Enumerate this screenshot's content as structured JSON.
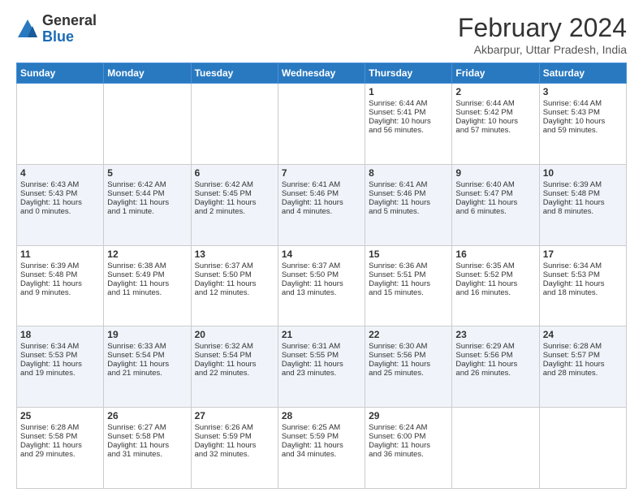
{
  "logo": {
    "general": "General",
    "blue": "Blue"
  },
  "title": "February 2024",
  "location": "Akbarpur, Uttar Pradesh, India",
  "headers": [
    "Sunday",
    "Monday",
    "Tuesday",
    "Wednesday",
    "Thursday",
    "Friday",
    "Saturday"
  ],
  "rows": [
    [
      {
        "day": "",
        "lines": []
      },
      {
        "day": "",
        "lines": []
      },
      {
        "day": "",
        "lines": []
      },
      {
        "day": "",
        "lines": []
      },
      {
        "day": "1",
        "lines": [
          "Sunrise: 6:44 AM",
          "Sunset: 5:41 PM",
          "Daylight: 10 hours",
          "and 56 minutes."
        ]
      },
      {
        "day": "2",
        "lines": [
          "Sunrise: 6:44 AM",
          "Sunset: 5:42 PM",
          "Daylight: 10 hours",
          "and 57 minutes."
        ]
      },
      {
        "day": "3",
        "lines": [
          "Sunrise: 6:44 AM",
          "Sunset: 5:43 PM",
          "Daylight: 10 hours",
          "and 59 minutes."
        ]
      }
    ],
    [
      {
        "day": "4",
        "lines": [
          "Sunrise: 6:43 AM",
          "Sunset: 5:43 PM",
          "Daylight: 11 hours",
          "and 0 minutes."
        ]
      },
      {
        "day": "5",
        "lines": [
          "Sunrise: 6:42 AM",
          "Sunset: 5:44 PM",
          "Daylight: 11 hours",
          "and 1 minute."
        ]
      },
      {
        "day": "6",
        "lines": [
          "Sunrise: 6:42 AM",
          "Sunset: 5:45 PM",
          "Daylight: 11 hours",
          "and 2 minutes."
        ]
      },
      {
        "day": "7",
        "lines": [
          "Sunrise: 6:41 AM",
          "Sunset: 5:46 PM",
          "Daylight: 11 hours",
          "and 4 minutes."
        ]
      },
      {
        "day": "8",
        "lines": [
          "Sunrise: 6:41 AM",
          "Sunset: 5:46 PM",
          "Daylight: 11 hours",
          "and 5 minutes."
        ]
      },
      {
        "day": "9",
        "lines": [
          "Sunrise: 6:40 AM",
          "Sunset: 5:47 PM",
          "Daylight: 11 hours",
          "and 6 minutes."
        ]
      },
      {
        "day": "10",
        "lines": [
          "Sunrise: 6:39 AM",
          "Sunset: 5:48 PM",
          "Daylight: 11 hours",
          "and 8 minutes."
        ]
      }
    ],
    [
      {
        "day": "11",
        "lines": [
          "Sunrise: 6:39 AM",
          "Sunset: 5:48 PM",
          "Daylight: 11 hours",
          "and 9 minutes."
        ]
      },
      {
        "day": "12",
        "lines": [
          "Sunrise: 6:38 AM",
          "Sunset: 5:49 PM",
          "Daylight: 11 hours",
          "and 11 minutes."
        ]
      },
      {
        "day": "13",
        "lines": [
          "Sunrise: 6:37 AM",
          "Sunset: 5:50 PM",
          "Daylight: 11 hours",
          "and 12 minutes."
        ]
      },
      {
        "day": "14",
        "lines": [
          "Sunrise: 6:37 AM",
          "Sunset: 5:50 PM",
          "Daylight: 11 hours",
          "and 13 minutes."
        ]
      },
      {
        "day": "15",
        "lines": [
          "Sunrise: 6:36 AM",
          "Sunset: 5:51 PM",
          "Daylight: 11 hours",
          "and 15 minutes."
        ]
      },
      {
        "day": "16",
        "lines": [
          "Sunrise: 6:35 AM",
          "Sunset: 5:52 PM",
          "Daylight: 11 hours",
          "and 16 minutes."
        ]
      },
      {
        "day": "17",
        "lines": [
          "Sunrise: 6:34 AM",
          "Sunset: 5:53 PM",
          "Daylight: 11 hours",
          "and 18 minutes."
        ]
      }
    ],
    [
      {
        "day": "18",
        "lines": [
          "Sunrise: 6:34 AM",
          "Sunset: 5:53 PM",
          "Daylight: 11 hours",
          "and 19 minutes."
        ]
      },
      {
        "day": "19",
        "lines": [
          "Sunrise: 6:33 AM",
          "Sunset: 5:54 PM",
          "Daylight: 11 hours",
          "and 21 minutes."
        ]
      },
      {
        "day": "20",
        "lines": [
          "Sunrise: 6:32 AM",
          "Sunset: 5:54 PM",
          "Daylight: 11 hours",
          "and 22 minutes."
        ]
      },
      {
        "day": "21",
        "lines": [
          "Sunrise: 6:31 AM",
          "Sunset: 5:55 PM",
          "Daylight: 11 hours",
          "and 23 minutes."
        ]
      },
      {
        "day": "22",
        "lines": [
          "Sunrise: 6:30 AM",
          "Sunset: 5:56 PM",
          "Daylight: 11 hours",
          "and 25 minutes."
        ]
      },
      {
        "day": "23",
        "lines": [
          "Sunrise: 6:29 AM",
          "Sunset: 5:56 PM",
          "Daylight: 11 hours",
          "and 26 minutes."
        ]
      },
      {
        "day": "24",
        "lines": [
          "Sunrise: 6:28 AM",
          "Sunset: 5:57 PM",
          "Daylight: 11 hours",
          "and 28 minutes."
        ]
      }
    ],
    [
      {
        "day": "25",
        "lines": [
          "Sunrise: 6:28 AM",
          "Sunset: 5:58 PM",
          "Daylight: 11 hours",
          "and 29 minutes."
        ]
      },
      {
        "day": "26",
        "lines": [
          "Sunrise: 6:27 AM",
          "Sunset: 5:58 PM",
          "Daylight: 11 hours",
          "and 31 minutes."
        ]
      },
      {
        "day": "27",
        "lines": [
          "Sunrise: 6:26 AM",
          "Sunset: 5:59 PM",
          "Daylight: 11 hours",
          "and 32 minutes."
        ]
      },
      {
        "day": "28",
        "lines": [
          "Sunrise: 6:25 AM",
          "Sunset: 5:59 PM",
          "Daylight: 11 hours",
          "and 34 minutes."
        ]
      },
      {
        "day": "29",
        "lines": [
          "Sunrise: 6:24 AM",
          "Sunset: 6:00 PM",
          "Daylight: 11 hours",
          "and 36 minutes."
        ]
      },
      {
        "day": "",
        "lines": []
      },
      {
        "day": "",
        "lines": []
      }
    ]
  ]
}
